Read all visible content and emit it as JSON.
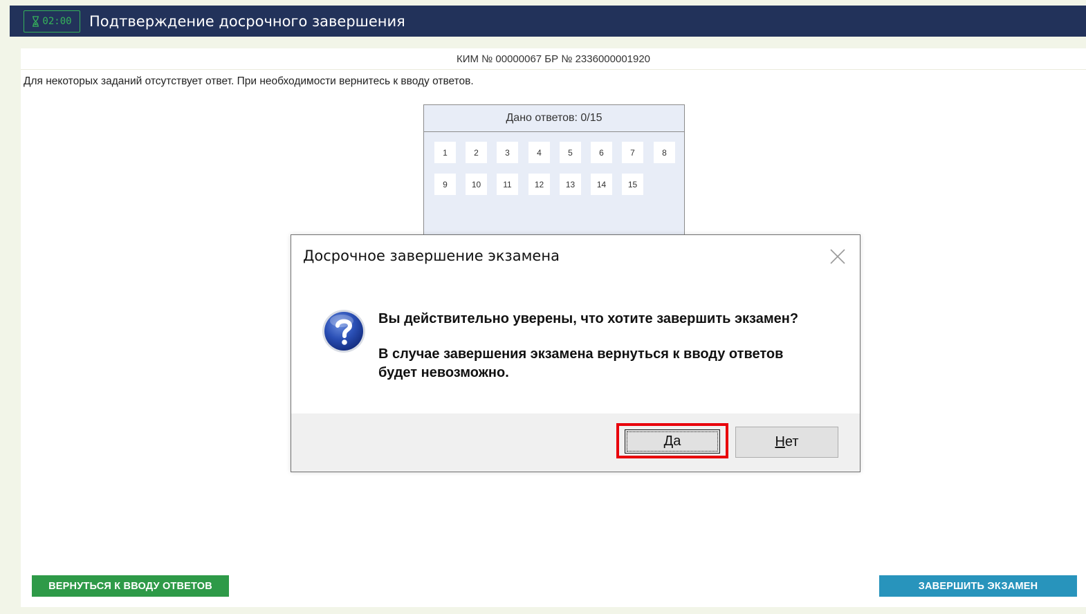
{
  "header": {
    "timer": "02:00",
    "title": "Подтверждение досрочного завершения"
  },
  "kim_line": "КИМ № 00000067 БР № 2336000001920",
  "notice": "Для некоторых заданий отсутствует ответ. При необходимости вернитесь к вводу ответов.",
  "answers": {
    "header": "Дано ответов: 0/15",
    "items": [
      "1",
      "2",
      "3",
      "4",
      "5",
      "6",
      "7",
      "8",
      "9",
      "10",
      "11",
      "12",
      "13",
      "14",
      "15"
    ]
  },
  "buttons": {
    "back": "ВЕРНУТЬСЯ К ВВОДУ ОТВЕТОВ",
    "finish": "ЗАВЕРШИТЬ ЭКЗАМЕН"
  },
  "dialog": {
    "title": "Досрочное завершение экзамена",
    "question": "Вы действительно уверены, что хотите завершить экзамен?",
    "warning": "В случае завершения экзамена вернуться к вводу ответов будет невозможно.",
    "yes_accel": "Д",
    "yes_rest": "а",
    "no_accel": "Н",
    "no_rest": "ет"
  },
  "colors": {
    "header_bg": "#22325a",
    "timer": "#36b35a",
    "back_button": "#2e9a48",
    "finish_button": "#2894bc",
    "highlight": "#e8000b"
  },
  "icons": [
    "hourglass-icon",
    "question-icon",
    "close-icon"
  ]
}
